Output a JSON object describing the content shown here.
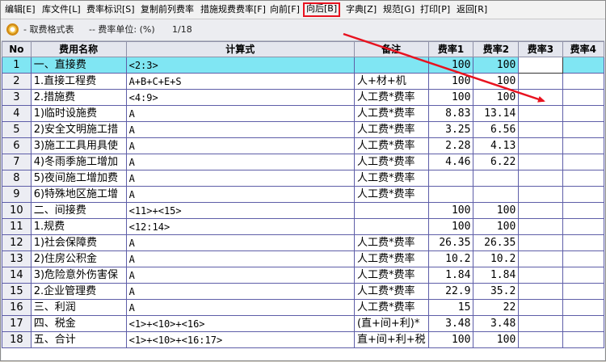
{
  "menu": [
    {
      "label": "编辑[E]"
    },
    {
      "label": "库文件[L]"
    },
    {
      "label": "费率标识[S]"
    },
    {
      "label": "复制前列费率"
    },
    {
      "label": "措施规费费率[F]"
    },
    {
      "label": "向前[F]"
    },
    {
      "label": "向后[B]"
    },
    {
      "label": "字典[Z]"
    },
    {
      "label": "规范[G]"
    },
    {
      "label": "打印[P]"
    },
    {
      "label": "返回[R]"
    }
  ],
  "subheader": {
    "title": "- 取费格式表",
    "unit": "-- 费率单位: (%)",
    "page": "1/18"
  },
  "table": {
    "headers": [
      "No",
      "费用名称",
      "计算式",
      "备注",
      "费率1",
      "费率2",
      "费率3",
      "费率4"
    ],
    "rows": [
      {
        "no": "1",
        "name": "一、直接费",
        "formula": "<2:3>",
        "note": "",
        "r1": "100",
        "r2": "100",
        "r3": "",
        "r4": ""
      },
      {
        "no": "2",
        "name": "1.直接工程费",
        "formula": "A+B+C+E+S",
        "note": "人+材+机",
        "r1": "100",
        "r2": "100",
        "r3": "",
        "r4": ""
      },
      {
        "no": "3",
        "name": "2.措施费",
        "formula": "<4:9>",
        "note": "人工费*费率",
        "r1": "100",
        "r2": "100",
        "r3": "",
        "r4": ""
      },
      {
        "no": "4",
        "name": "1)临时设施费",
        "formula": "A",
        "note": "人工费*费率",
        "r1": "8.83",
        "r2": "13.14",
        "r3": "",
        "r4": ""
      },
      {
        "no": "5",
        "name": "2)安全文明施工措",
        "formula": "A",
        "note": "人工费*费率",
        "r1": "3.25",
        "r2": "6.56",
        "r3": "",
        "r4": ""
      },
      {
        "no": "6",
        "name": "3)施工工具用具使",
        "formula": "A",
        "note": "人工费*费率",
        "r1": "2.28",
        "r2": "4.13",
        "r3": "",
        "r4": ""
      },
      {
        "no": "7",
        "name": "4)冬雨季施工增加",
        "formula": "A",
        "note": "人工费*费率",
        "r1": "4.46",
        "r2": "6.22",
        "r3": "",
        "r4": ""
      },
      {
        "no": "8",
        "name": "5)夜间施工增加费",
        "formula": "A",
        "note": "人工费*费率",
        "r1": "",
        "r2": "",
        "r3": "",
        "r4": ""
      },
      {
        "no": "9",
        "name": "6)特殊地区施工增",
        "formula": "A",
        "note": "人工费*费率",
        "r1": "",
        "r2": "",
        "r3": "",
        "r4": ""
      },
      {
        "no": "10",
        "name": "二、间接费",
        "formula": "<11>+<15>",
        "note": "",
        "r1": "100",
        "r2": "100",
        "r3": "",
        "r4": ""
      },
      {
        "no": "11",
        "name": "1.规费",
        "formula": "<12:14>",
        "note": "",
        "r1": "100",
        "r2": "100",
        "r3": "",
        "r4": ""
      },
      {
        "no": "12",
        "name": "1)社会保障费",
        "formula": "A",
        "note": "人工费*费率",
        "r1": "26.35",
        "r2": "26.35",
        "r3": "",
        "r4": ""
      },
      {
        "no": "13",
        "name": "2)住房公积金",
        "formula": "A",
        "note": "人工费*费率",
        "r1": "10.2",
        "r2": "10.2",
        "r3": "",
        "r4": ""
      },
      {
        "no": "14",
        "name": "3)危险意外伤害保",
        "formula": "A",
        "note": "人工费*费率",
        "r1": "1.84",
        "r2": "1.84",
        "r3": "",
        "r4": ""
      },
      {
        "no": "15",
        "name": "2.企业管理费",
        "formula": "A",
        "note": "人工费*费率",
        "r1": "22.9",
        "r2": "35.2",
        "r3": "",
        "r4": ""
      },
      {
        "no": "16",
        "name": "三、利润",
        "formula": "A",
        "note": "人工费*费率",
        "r1": "15",
        "r2": "22",
        "r3": "",
        "r4": ""
      },
      {
        "no": "17",
        "name": "四、税金",
        "formula": "<1>+<10>+<16>",
        "note": "(直+间+利)*",
        "r1": "3.48",
        "r2": "3.48",
        "r3": "",
        "r4": ""
      },
      {
        "no": "18",
        "name": "五、合计",
        "formula": "<1>+<10>+<16:17>",
        "note": "直+间+利+税",
        "r1": "100",
        "r2": "100",
        "r3": "",
        "r4": ""
      }
    ]
  },
  "colors": {
    "highlight": "#e8121f",
    "selected_row": "#80e6f3",
    "grid_line": "#5e5ea8"
  }
}
